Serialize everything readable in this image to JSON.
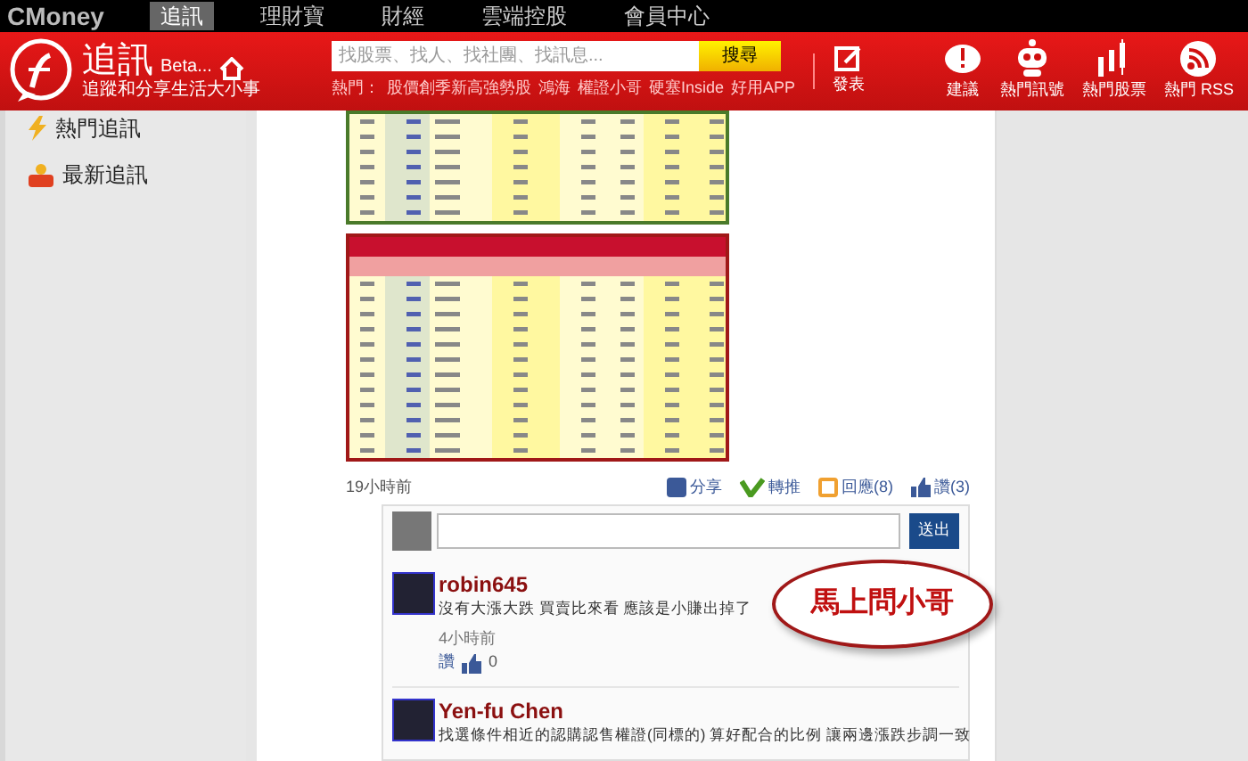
{
  "top_bar": {
    "logo": "CMoney",
    "nav": [
      {
        "label": "追訊",
        "selected": true
      },
      {
        "label": "理財寶",
        "selected": false
      },
      {
        "label": "財經",
        "selected": false
      },
      {
        "label": "雲端控股",
        "selected": false
      },
      {
        "label": "會員中心",
        "selected": false
      }
    ]
  },
  "header": {
    "brand": "追訊",
    "beta": "Beta...",
    "tagline": "追蹤和分享生活大小事",
    "search": {
      "placeholder": "找股票、找人、找社團、找訊息..."
    },
    "search_button": "搜尋",
    "hot_label": "熱門：",
    "hot_links": [
      "股價創季新高強勢股",
      "鴻海",
      "權證小哥",
      "硬塞Inside",
      "好用APP"
    ],
    "post_button": "發表",
    "tools": [
      {
        "kind": "suggest",
        "label": "建議"
      },
      {
        "kind": "robot",
        "label": "熱門訊號"
      },
      {
        "kind": "chart",
        "label": "熱門股票"
      },
      {
        "kind": "rss",
        "label": "熱門 RSS"
      }
    ]
  },
  "sidebar": {
    "items": [
      {
        "kind": "hot",
        "label": "熱門追訊"
      },
      {
        "kind": "new",
        "label": "最新追訊"
      }
    ]
  },
  "post": {
    "time": "19小時前",
    "actions": [
      {
        "kind": "share",
        "label": "分享"
      },
      {
        "kind": "repost",
        "label": "轉推"
      },
      {
        "kind": "reply",
        "label": "回應(8)"
      },
      {
        "kind": "like",
        "label": "讚(3)"
      }
    ],
    "send_button": "送出",
    "callout": "馬上問小哥",
    "comments": [
      {
        "author": "robin645",
        "text": "沒有大漲大跌 買賣比來看 應該是小賺出掉了",
        "time": "4小時前",
        "like": "讚",
        "likes": "0"
      },
      {
        "author": "Yen-fu Chen",
        "text": "找選條件相近的認購認售權證(同標的) 算好配合的比例 讓兩邊漲跌步調一致"
      }
    ]
  }
}
